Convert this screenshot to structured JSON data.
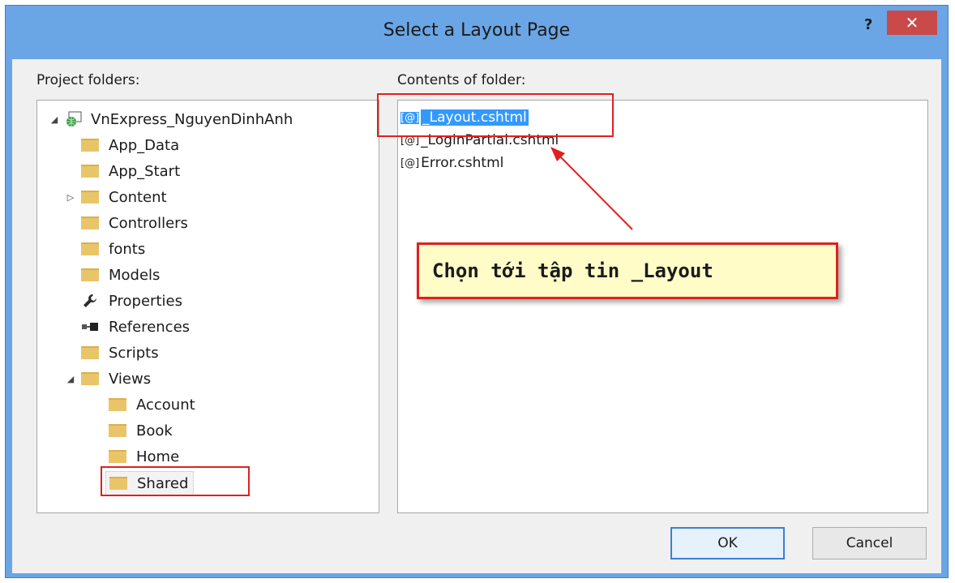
{
  "dialog": {
    "title": "Select a Layout Page",
    "help_label": "?",
    "close_label": "✕"
  },
  "left": {
    "label": "Project folders:",
    "tree": [
      {
        "label": "VnExpress_NguyenDinhAnh",
        "icon": "web-project-icon",
        "expander": "◢"
      },
      {
        "label": "App_Data",
        "icon": "folder-icon",
        "expander": ""
      },
      {
        "label": "App_Start",
        "icon": "folder-icon",
        "expander": ""
      },
      {
        "label": "Content",
        "icon": "folder-icon",
        "expander": "▷"
      },
      {
        "label": "Controllers",
        "icon": "folder-icon",
        "expander": ""
      },
      {
        "label": "fonts",
        "icon": "folder-icon",
        "expander": ""
      },
      {
        "label": "Models",
        "icon": "folder-icon",
        "expander": ""
      },
      {
        "label": "Properties",
        "icon": "wrench-icon",
        "expander": ""
      },
      {
        "label": "References",
        "icon": "references-icon",
        "expander": ""
      },
      {
        "label": "Scripts",
        "icon": "folder-icon",
        "expander": ""
      },
      {
        "label": "Views",
        "icon": "folder-icon",
        "expander": "◢"
      },
      {
        "label": "Account",
        "icon": "folder-icon",
        "expander": ""
      },
      {
        "label": "Book",
        "icon": "folder-icon",
        "expander": ""
      },
      {
        "label": "Home",
        "icon": "folder-icon",
        "expander": ""
      },
      {
        "label": "Shared",
        "icon": "folder-icon",
        "expander": ""
      }
    ]
  },
  "right": {
    "label": "Contents of folder:",
    "files": [
      {
        "label": "_Layout.cshtml",
        "icon_text": "[@]",
        "selected": true
      },
      {
        "label": "_LoginPartial.cshtml",
        "icon_text": "[@]",
        "selected": false
      },
      {
        "label": "Error.cshtml",
        "icon_text": "[@]",
        "selected": false
      }
    ]
  },
  "annotation": {
    "text": "Chọn tới tập tin _Layout"
  },
  "buttons": {
    "ok": "OK",
    "cancel": "Cancel"
  },
  "colors": {
    "window_frame": "#6aa6e6",
    "close_button": "#c94a48",
    "selection": "#3399ff",
    "annotation_border": "#e02020",
    "callout_fill": "#fffcc8"
  }
}
